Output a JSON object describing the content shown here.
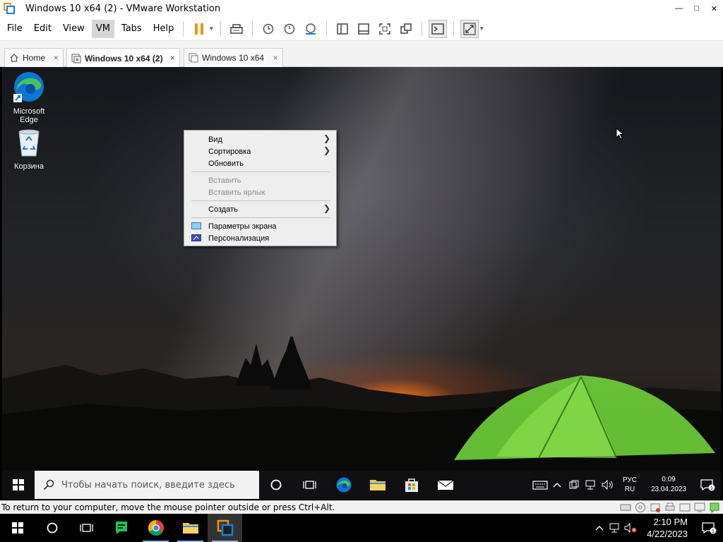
{
  "window": {
    "title": "Windows 10 x64 (2) - VMware Workstation",
    "minimize_glyph": "—",
    "maximize_glyph": "□",
    "close_glyph": "✕"
  },
  "menu": {
    "file": "File",
    "edit": "Edit",
    "view": "View",
    "vm": "VM",
    "tabs": "Tabs",
    "help": "Help"
  },
  "tabs": {
    "home": "Home",
    "active": "Windows 10 x64 (2)",
    "other": "Windows 10 x64",
    "close_glyph": "✕"
  },
  "desktop": {
    "icons": {
      "edge_line1": "Microsoft",
      "edge_line2": "Edge",
      "recycle": "Корзина"
    }
  },
  "context_menu": {
    "view": "Вид",
    "sort": "Сортировка",
    "refresh": "Обновить",
    "paste": "Вставить",
    "paste_shortcut": "Вставить ярлык",
    "new": "Создать",
    "display_settings": "Параметры экрана",
    "personalize": "Персонализация",
    "arrow_glyph": "❯"
  },
  "guest_taskbar": {
    "search_placeholder": "Чтобы начать поиск, введите здесь",
    "lang_line1": "РУС",
    "lang_line2": "RU",
    "time": "0:09",
    "date": "23.04.2023",
    "notification_count": "1"
  },
  "status": {
    "message": "To return to your computer, move the mouse pointer outside or press Ctrl+Alt."
  },
  "host_taskbar": {
    "time": "2:10 PM",
    "date": "4/22/2023",
    "notification_count": "1"
  },
  "colors": {
    "pause_orange": "#f29111",
    "edge_blue": "#0c76d6",
    "edge_green": "#46c35b",
    "tent_green": "#6fd13a",
    "chat_green": "#20c05a"
  }
}
